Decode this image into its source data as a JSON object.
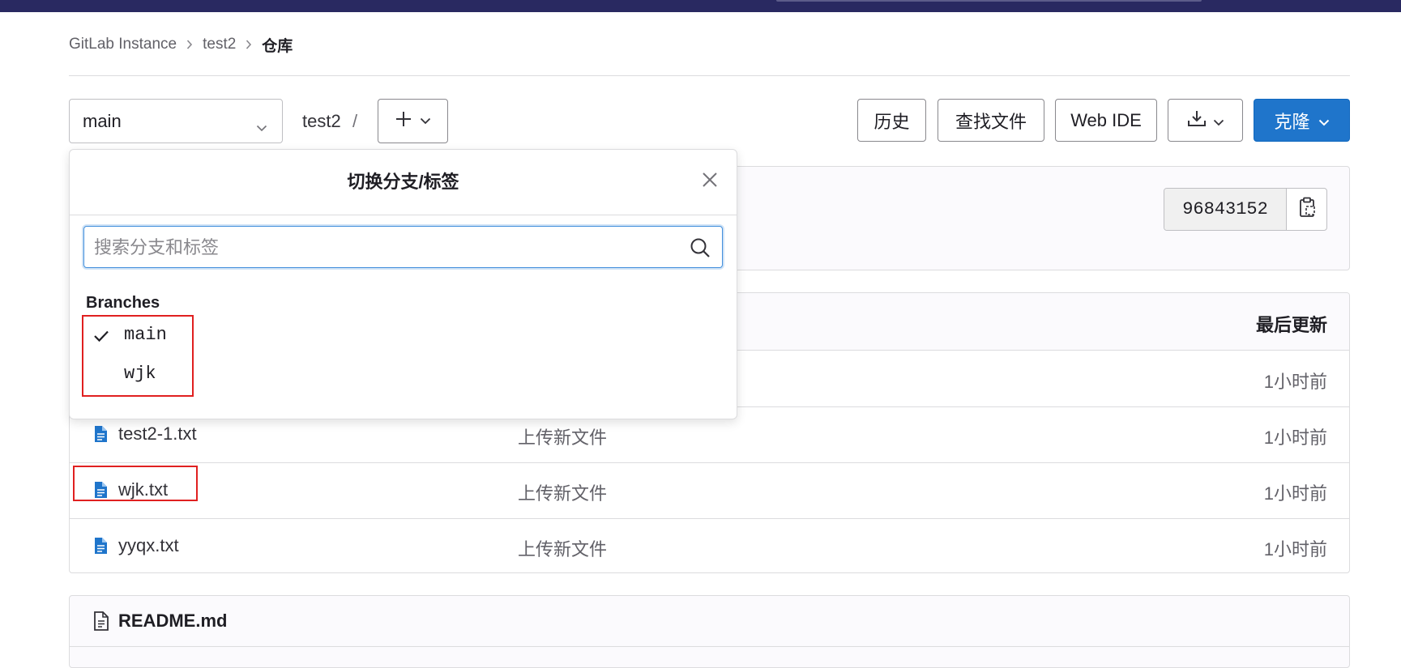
{
  "breadcrumb": {
    "items": [
      "GitLab Instance",
      "test2"
    ],
    "current": "仓库"
  },
  "toolbar": {
    "branch": "main",
    "path_project": "test2",
    "path_separator": "/",
    "history": "历史",
    "find_file": "查找文件",
    "web_ide": "Web IDE",
    "clone": "克隆"
  },
  "commit": {
    "sha": "96843152"
  },
  "files": {
    "header_updated": "最后更新",
    "rows": [
      {
        "name": "",
        "message": "",
        "updated": "1小时前"
      },
      {
        "name": "test2-1.txt",
        "message": "上传新文件",
        "updated": "1小时前"
      },
      {
        "name": "wjk.txt",
        "message": "上传新文件",
        "updated": "1小时前"
      },
      {
        "name": "yyqx.txt",
        "message": "上传新文件",
        "updated": "1小时前"
      }
    ]
  },
  "readme": {
    "title": "README.md"
  },
  "branch_dropdown": {
    "title": "切换分支/标签",
    "search_placeholder": "搜索分支和标签",
    "section_label": "Branches",
    "branches": [
      {
        "name": "main",
        "selected": true
      },
      {
        "name": "wjk",
        "selected": false
      }
    ]
  },
  "colors": {
    "accent": "#1f75cb",
    "topbar": "#292961",
    "highlight": "#e02020"
  }
}
